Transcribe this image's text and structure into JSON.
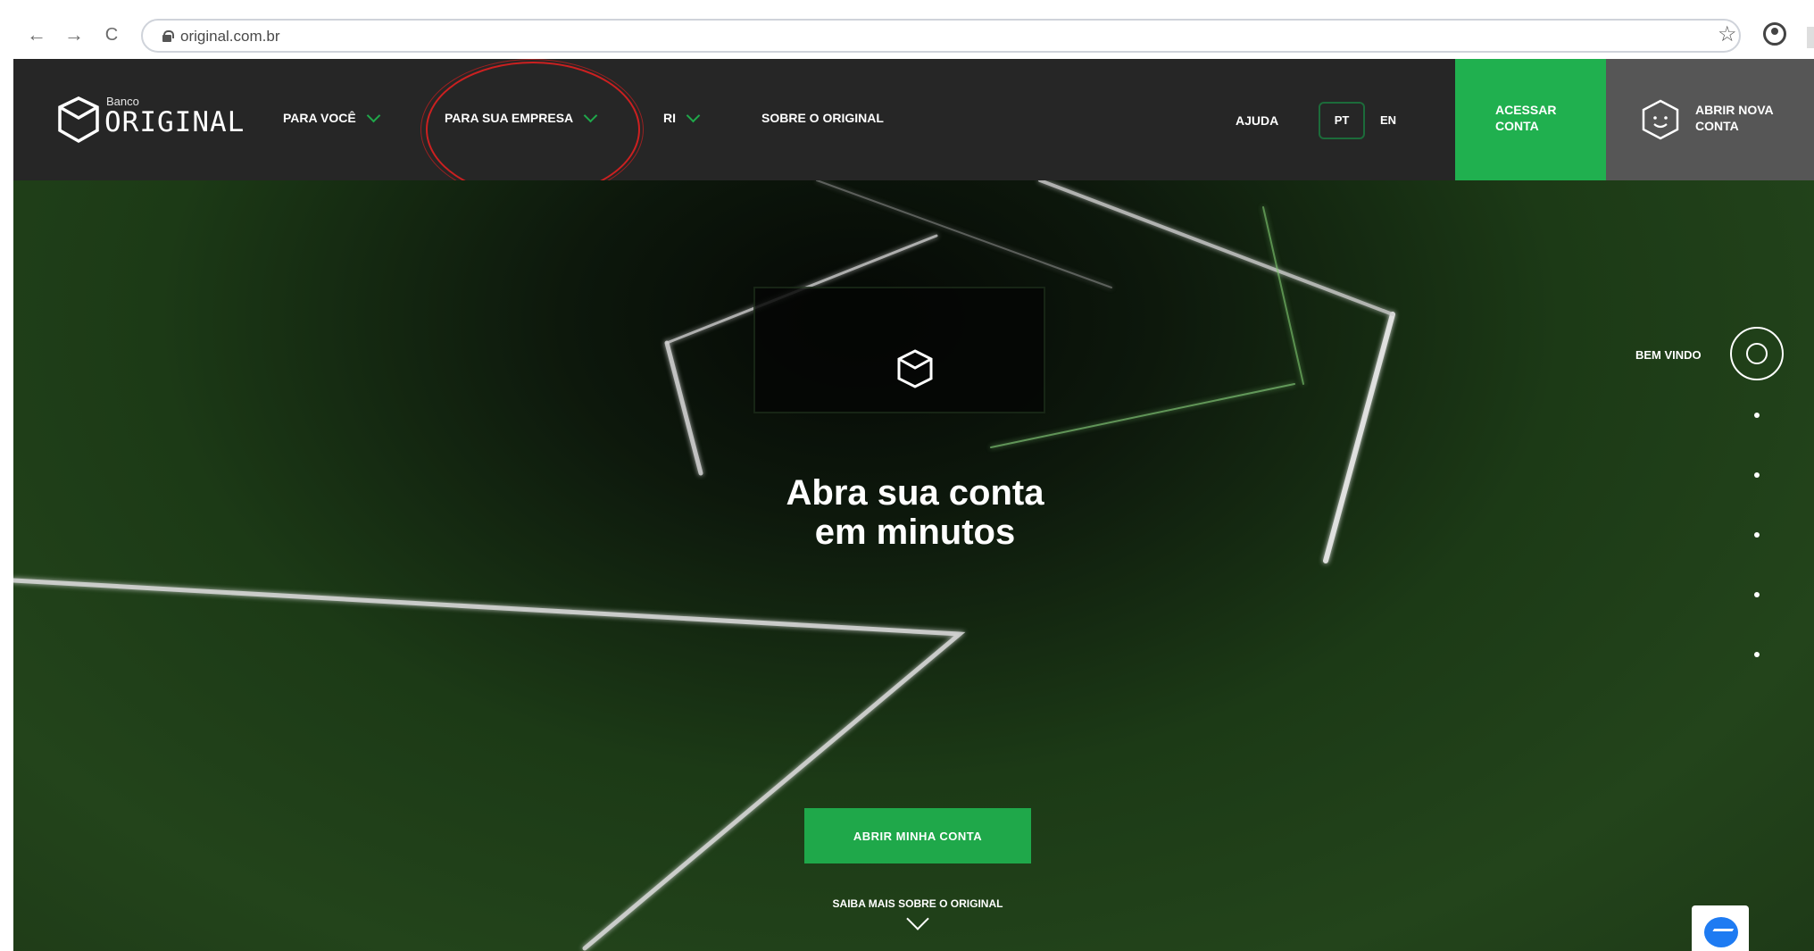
{
  "browser": {
    "back": "←",
    "forward": "→",
    "reload": "C",
    "url": "original.com.br",
    "bookmark": "☆"
  },
  "header": {
    "logo_small": "Banco",
    "logo_word": "ORIGINAL",
    "nav": [
      "PARA VOCÊ",
      "PARA SUA EMPRESA",
      "RI",
      "SOBRE O ORIGINAL"
    ],
    "help": "AJUDA",
    "lang_pt": "PT",
    "lang_en": "EN",
    "access_line1": "ACESSAR",
    "access_line2": "CONTA",
    "open_line1": "ABRIR NOVA",
    "open_line2": "CONTA"
  },
  "hero": {
    "headline_line1": "Abra sua conta",
    "headline_line2": "em minutos",
    "cta": "ABRIR MINHA CONTA",
    "learn_more": "SAIBA MAIS SOBRE O ORIGINAL",
    "section_label": "BEM VINDO"
  },
  "colors": {
    "brand_green": "#20b04f",
    "header_bg": "#262626",
    "annotation_red": "#cc2020"
  },
  "icons": [
    "lock-icon",
    "star-icon",
    "profile-icon",
    "cube-logo-icon",
    "chevron-down-icon",
    "smiley-cube-icon",
    "messenger-icon"
  ]
}
